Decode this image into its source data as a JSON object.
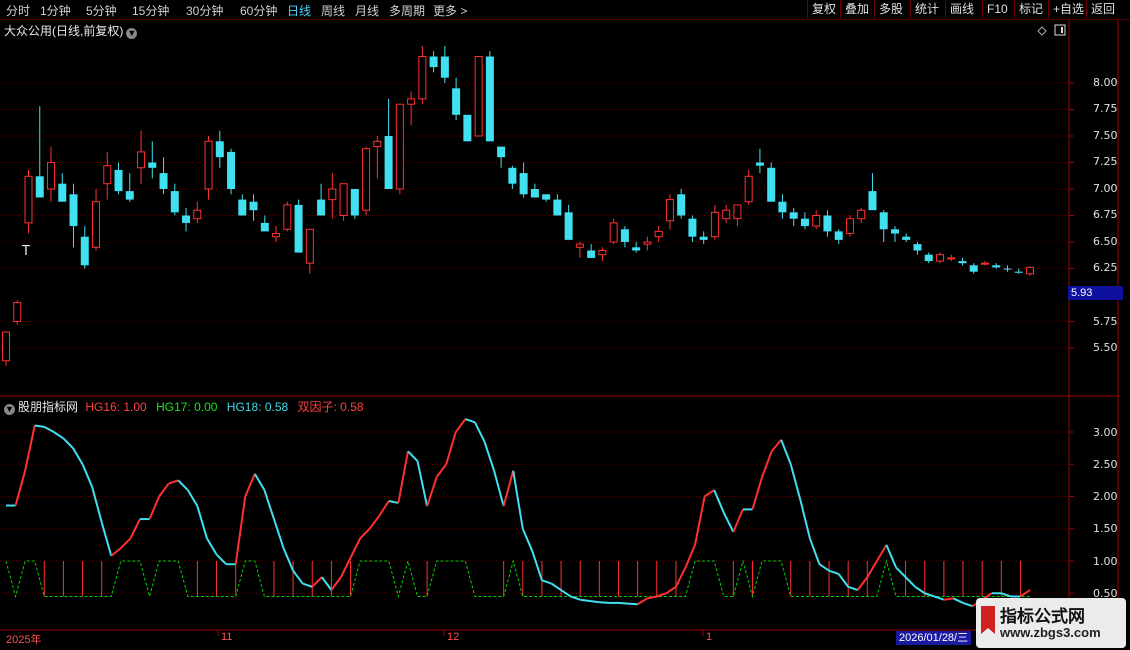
{
  "toolbar": {
    "timeframes": [
      "分时",
      "1分钟",
      "5分钟",
      "15分钟",
      "30分钟",
      "60分钟",
      "日线",
      "周线",
      "月线",
      "多周期",
      "更多"
    ],
    "active_timeframe": "日线",
    "more_arrow": ">",
    "buttons": [
      "复权",
      "叠加",
      "多股",
      "统计",
      "画线",
      "F10",
      "标记",
      "+自选",
      "返回"
    ]
  },
  "main_panel": {
    "title": "大众公用(日线,前复权)",
    "y_ticks": [
      "8.00",
      "7.75",
      "7.50",
      "7.25",
      "7.00",
      "6.75",
      "6.50",
      "6.25",
      "5.75",
      "5.50"
    ],
    "current_price": "5.93",
    "t_marker": "T"
  },
  "indicator_panel": {
    "name": "股朋指标网",
    "hg16": "HG16: 1.00",
    "hg17": "HG17: 0.00",
    "hg18": "HG18: 0.58",
    "factor": "双因子: 0.58",
    "y_ticks": [
      "3.00",
      "2.50",
      "2.00",
      "1.50",
      "1.00",
      "0.50"
    ]
  },
  "x_axis": {
    "labels": [
      "2025年",
      "11",
      "12",
      "1"
    ],
    "cursor_date": "2026/01/28/三"
  },
  "watermark": {
    "title": "指标公式网",
    "url": "www.zbgs3.com"
  },
  "colors": {
    "up": "#ff3030",
    "down": "#40e0f0",
    "hg17": "#00d000",
    "axis": "#a00000",
    "active": "#4fd0ff"
  },
  "chart_data": [
    {
      "type": "candlestick",
      "title": "大众公用(日线,前复权)",
      "ylim": [
        5.3,
        8.3
      ],
      "candles": [
        [
          5.38,
          5.65,
          5.33,
          5.65
        ],
        [
          5.75,
          5.95,
          5.72,
          5.93
        ],
        [
          6.68,
          7.18,
          6.58,
          7.12
        ],
        [
          7.12,
          7.78,
          6.95,
          6.92
        ],
        [
          7.0,
          7.4,
          6.88,
          7.25
        ],
        [
          7.05,
          7.15,
          6.88,
          6.88
        ],
        [
          6.95,
          7.05,
          6.45,
          6.65
        ],
        [
          6.55,
          6.65,
          6.25,
          6.28
        ],
        [
          6.45,
          7.0,
          6.42,
          6.88
        ],
        [
          7.05,
          7.35,
          6.9,
          7.22
        ],
        [
          7.18,
          7.25,
          6.95,
          6.98
        ],
        [
          6.98,
          7.15,
          6.88,
          6.9
        ],
        [
          7.2,
          7.55,
          7.05,
          7.35
        ],
        [
          7.25,
          7.45,
          7.1,
          7.2
        ],
        [
          7.15,
          7.3,
          6.95,
          7.0
        ],
        [
          6.98,
          7.05,
          6.75,
          6.78
        ],
        [
          6.75,
          6.82,
          6.6,
          6.68
        ],
        [
          6.72,
          6.88,
          6.68,
          6.8
        ],
        [
          7.0,
          7.5,
          6.9,
          7.45
        ],
        [
          7.45,
          7.55,
          7.2,
          7.3
        ],
        [
          7.35,
          7.38,
          6.95,
          7.0
        ],
        [
          6.9,
          6.95,
          6.75,
          6.75
        ],
        [
          6.88,
          6.95,
          6.7,
          6.8
        ],
        [
          6.68,
          6.75,
          6.6,
          6.6
        ],
        [
          6.55,
          6.65,
          6.5,
          6.58
        ],
        [
          6.62,
          6.88,
          6.6,
          6.85
        ],
        [
          6.85,
          6.9,
          6.4,
          6.4
        ],
        [
          6.3,
          6.62,
          6.2,
          6.62
        ],
        [
          6.9,
          7.05,
          6.82,
          6.75
        ],
        [
          6.9,
          7.15,
          6.72,
          7.0
        ],
        [
          6.75,
          7.05,
          6.7,
          7.05
        ],
        [
          7.0,
          6.95,
          6.72,
          6.75
        ],
        [
          6.8,
          7.4,
          6.75,
          7.38
        ],
        [
          7.4,
          7.5,
          7.1,
          7.45
        ],
        [
          7.5,
          7.85,
          7.3,
          7.0
        ],
        [
          7.0,
          7.5,
          6.95,
          7.8
        ],
        [
          7.8,
          7.92,
          7.6,
          7.85
        ],
        [
          7.85,
          8.35,
          7.8,
          8.25
        ],
        [
          8.25,
          8.3,
          8.1,
          8.15
        ],
        [
          8.25,
          8.35,
          8.0,
          8.05
        ],
        [
          7.95,
          8.05,
          7.65,
          7.7
        ],
        [
          7.7,
          7.65,
          7.45,
          7.45
        ],
        [
          7.5,
          8.25,
          7.5,
          8.25
        ],
        [
          8.25,
          8.3,
          7.45,
          7.45
        ],
        [
          7.4,
          7.35,
          7.2,
          7.3
        ],
        [
          7.2,
          7.22,
          7.0,
          7.05
        ],
        [
          7.15,
          7.25,
          6.92,
          6.95
        ],
        [
          7.0,
          7.05,
          6.92,
          6.92
        ],
        [
          6.95,
          6.95,
          6.88,
          6.9
        ],
        [
          6.9,
          6.95,
          6.75,
          6.75
        ],
        [
          6.78,
          6.85,
          6.55,
          6.52
        ],
        [
          6.45,
          6.5,
          6.35,
          6.48
        ],
        [
          6.42,
          6.48,
          6.35,
          6.35
        ],
        [
          6.38,
          6.45,
          6.32,
          6.42
        ],
        [
          6.5,
          6.72,
          6.48,
          6.68
        ],
        [
          6.62,
          6.65,
          6.45,
          6.5
        ],
        [
          6.45,
          6.5,
          6.4,
          6.42
        ],
        [
          6.48,
          6.55,
          6.42,
          6.5
        ],
        [
          6.55,
          6.65,
          6.5,
          6.6
        ],
        [
          6.7,
          6.95,
          6.62,
          6.9
        ],
        [
          6.95,
          7.0,
          6.72,
          6.75
        ],
        [
          6.72,
          6.75,
          6.5,
          6.55
        ],
        [
          6.55,
          6.6,
          6.48,
          6.52
        ],
        [
          6.55,
          6.85,
          6.52,
          6.78
        ],
        [
          6.72,
          6.85,
          6.68,
          6.8
        ],
        [
          6.72,
          6.8,
          6.65,
          6.85
        ],
        [
          6.88,
          7.18,
          6.85,
          7.12
        ],
        [
          7.25,
          7.38,
          7.15,
          7.22
        ],
        [
          7.2,
          7.25,
          6.9,
          6.88
        ],
        [
          6.88,
          6.95,
          6.72,
          6.78
        ],
        [
          6.78,
          6.82,
          6.65,
          6.72
        ],
        [
          6.72,
          6.78,
          6.62,
          6.65
        ],
        [
          6.65,
          6.8,
          6.62,
          6.75
        ],
        [
          6.75,
          6.8,
          6.55,
          6.6
        ],
        [
          6.6,
          6.62,
          6.48,
          6.52
        ],
        [
          6.58,
          6.75,
          6.55,
          6.72
        ],
        [
          6.72,
          6.82,
          6.68,
          6.8
        ],
        [
          6.98,
          7.15,
          6.82,
          6.8
        ],
        [
          6.78,
          6.8,
          6.5,
          6.62
        ],
        [
          6.62,
          6.65,
          6.5,
          6.58
        ],
        [
          6.55,
          6.58,
          6.5,
          6.52
        ],
        [
          6.48,
          6.5,
          6.38,
          6.42
        ],
        [
          6.38,
          6.4,
          6.3,
          6.32
        ],
        [
          6.32,
          6.4,
          6.3,
          6.38
        ],
        [
          6.35,
          6.38,
          6.32,
          6.35
        ],
        [
          6.32,
          6.35,
          6.28,
          6.3
        ],
        [
          6.28,
          6.3,
          6.2,
          6.22
        ],
        [
          6.3,
          6.32,
          6.28,
          6.3
        ],
        [
          6.28,
          6.3,
          6.25,
          6.26
        ],
        [
          6.25,
          6.28,
          6.22,
          6.24
        ],
        [
          6.22,
          6.25,
          6.2,
          6.21
        ],
        [
          6.2,
          6.27,
          6.18,
          6.26
        ]
      ]
    },
    {
      "type": "line",
      "title": "股朋指标网",
      "ylim": [
        0.4,
        3.3
      ],
      "series": [
        {
          "name": "HG18",
          "color_rule": "red when rising, cyan when falling",
          "values": [
            1.86,
            1.86,
            2.4,
            3.1,
            3.08,
            3.0,
            2.9,
            2.75,
            2.5,
            2.15,
            1.6,
            1.08,
            1.2,
            1.35,
            1.65,
            1.65,
            2.0,
            2.2,
            2.25,
            2.1,
            1.85,
            1.35,
            1.1,
            0.95,
            0.95,
            2.0,
            2.35,
            2.1,
            1.65,
            1.2,
            0.85,
            0.65,
            0.6,
            0.75,
            0.55,
            0.75,
            1.05,
            1.35,
            1.5,
            1.7,
            1.93,
            1.9,
            2.7,
            2.55,
            1.85,
            2.3,
            2.5,
            3.0,
            3.2,
            3.15,
            2.85,
            2.4,
            1.85,
            2.4,
            1.5,
            1.15,
            0.7,
            0.65,
            0.55,
            0.45,
            0.4,
            0.38,
            0.36,
            0.35,
            0.35,
            0.34,
            0.33,
            0.42,
            0.45,
            0.5,
            0.6,
            0.9,
            1.25,
            2.0,
            2.1,
            1.75,
            1.45,
            1.8,
            1.8,
            2.3,
            2.7,
            2.88,
            2.5,
            1.95,
            1.35,
            0.95,
            0.85,
            0.8,
            0.6,
            0.55,
            0.75,
            1.0,
            1.25,
            0.9,
            0.75,
            0.6,
            0.5,
            0.45,
            0.4,
            0.42,
            0.35,
            0.3,
            0.4,
            0.5,
            0.5,
            0.45,
            0.45,
            0.55
          ]
        },
        {
          "name": "HG16",
          "values": "vertical red bars to 1.00 on marked days"
        },
        {
          "name": "HG17",
          "values": "green dashed step line between 0.45 and 1.00"
        }
      ]
    }
  ]
}
